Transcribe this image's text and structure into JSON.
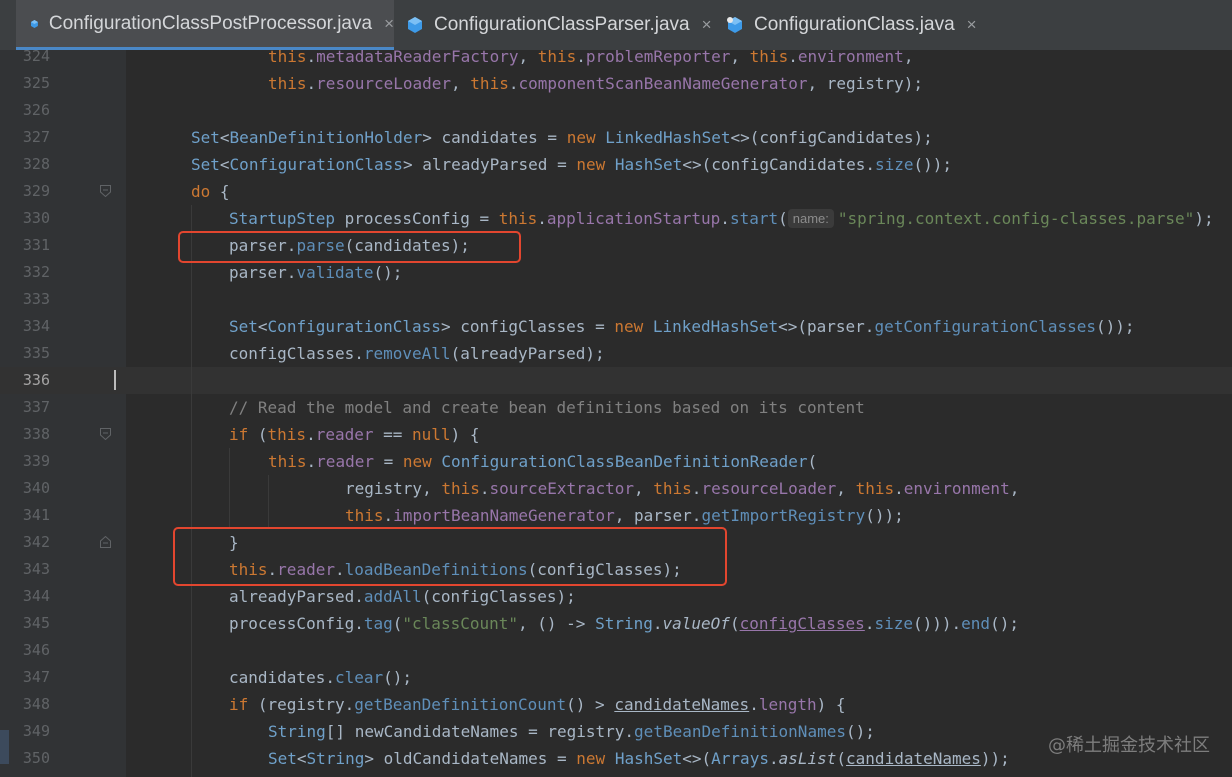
{
  "tabs": [
    {
      "label": "ConfigurationClassPostProcessor.java",
      "active": true,
      "icon": "java-class-icon",
      "icon_color": "#3d9ae8"
    },
    {
      "label": "ConfigurationClassParser.java",
      "active": false,
      "icon": "java-class-icon",
      "icon_color": "#3d9ae8"
    },
    {
      "label": "ConfigurationClass.java",
      "active": false,
      "icon": "java-annotated-class-icon",
      "icon_color": "#3d9ae8"
    }
  ],
  "close_glyph": "×",
  "editor": {
    "current_line": "336",
    "line_numbers": [
      "324",
      "325",
      "326",
      "327",
      "328",
      "329",
      "330",
      "331",
      "332",
      "333",
      "334",
      "335",
      "336",
      "337",
      "338",
      "339",
      "340",
      "341",
      "342",
      "343",
      "344",
      "345",
      "346",
      "347",
      "348",
      "349",
      "350"
    ],
    "param_hint": "name:",
    "highlight_color": "#e2462f"
  },
  "watermark": "@稀土掘金技术社区"
}
